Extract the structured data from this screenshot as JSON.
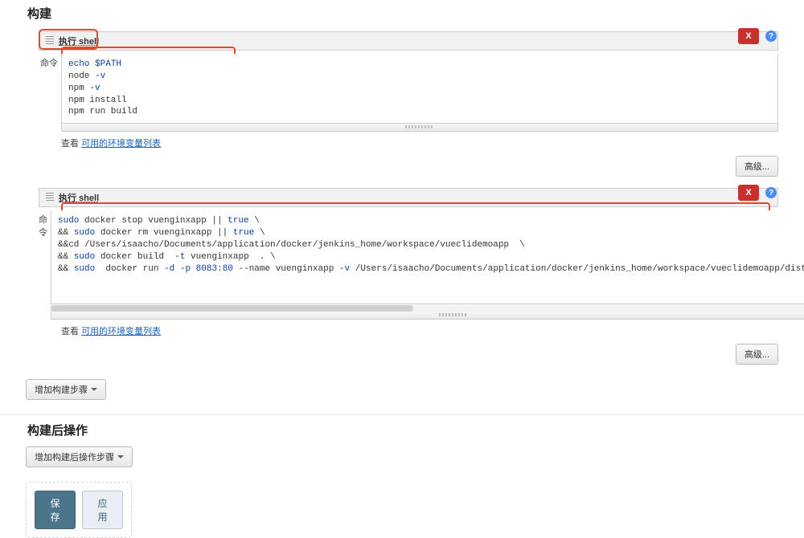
{
  "section_build": "构建",
  "section_post": "构建后操作",
  "step1": {
    "title": "执行 shell",
    "label": "命令",
    "code_html": "<span class='kw'>echo</span> <span class='var'>$PATH</span>\nnode <span class='kw'>-v</span>\nnpm <span class='kw'>-v</span>\nnpm install\nnpm run build",
    "see_prefix": "查看 ",
    "see_link": "可用的环境变量列表",
    "advanced": "高级...",
    "delete": "X"
  },
  "step2": {
    "title": "执行 shell",
    "label": "命令",
    "code_html": "<span class='kw'>sudo</span> docker stop vuenginxapp || <span class='kw'>true</span> \\\n&& <span class='kw'>sudo</span> docker rm vuenginxapp || <span class='kw'>true</span> \\\n&&cd /Users/isaacho/Documents/application/docker/jenkins_home/workspace/vueclidemoapp  \\\n&& <span class='kw'>sudo</span> docker build  <span class='kw'>-t</span> vuenginxapp  . \\\n&& <span class='kw'>sudo</span>  docker run <span class='kw'>-d -p</span> <span class='num'>8083</span>:<span class='num'>80</span> --name vuenginxapp <span class='kw'>-v</span> /Users/isaacho/Documents/application/docker/jenkins_home/workspace/vueclidemoapp/dist:/usr/sh",
    "see_prefix": "查看 ",
    "see_link": "可用的环境变量列表",
    "advanced": "高级...",
    "delete": "X"
  },
  "add_build_step": "增加构建步骤",
  "add_post_step": "增加构建后操作步骤",
  "save": "保存",
  "apply": "应用"
}
